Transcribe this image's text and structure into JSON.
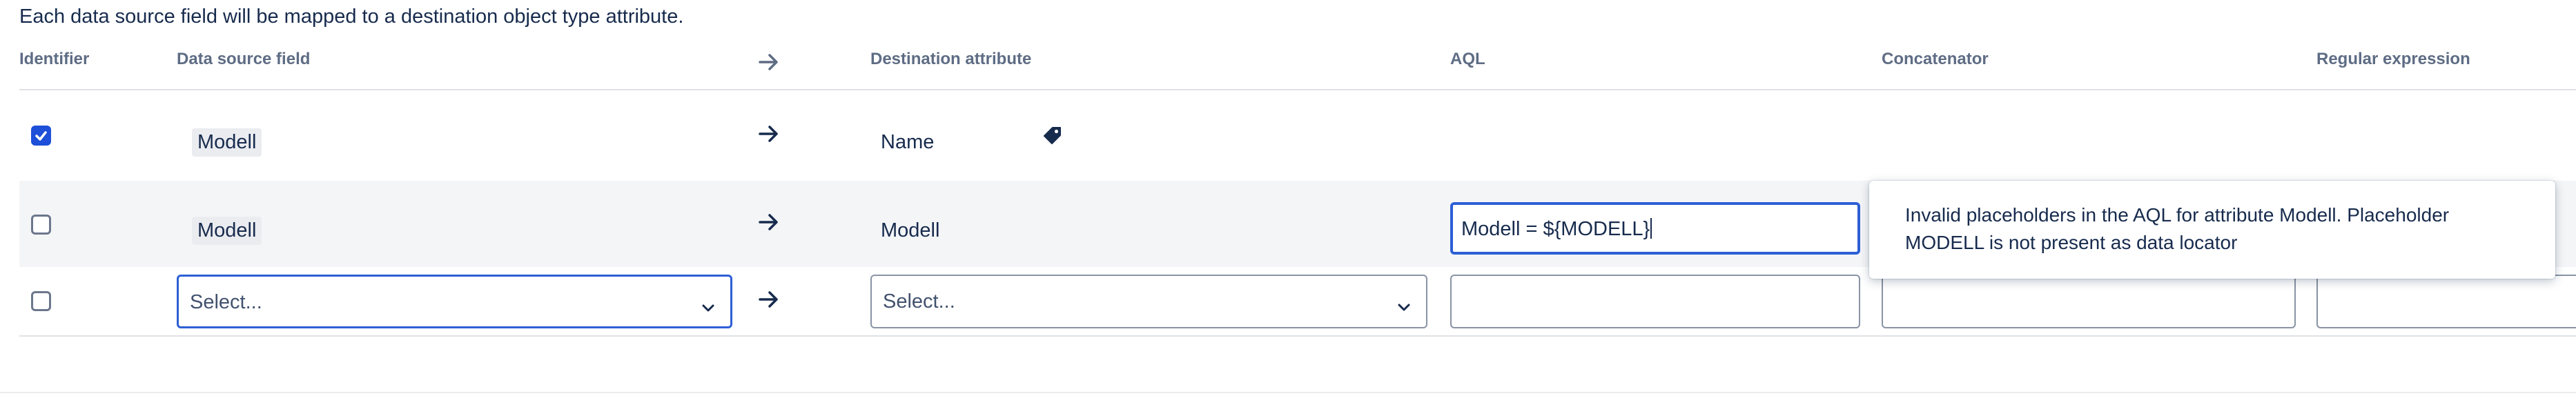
{
  "intro_text": "Each data source field will be mapped to a destination object type attribute.",
  "headers": {
    "identifier": "Identifier",
    "data_source_field": "Data source field",
    "destination_attribute": "Destination attribute",
    "aql": "AQL",
    "concatenator": "Concatenator",
    "regular_expression": "Regular expression"
  },
  "rows": [
    {
      "identifier_checked": true,
      "data_source_field": "Modell",
      "destination_attribute": "Name",
      "destination_icon": "tag-icon"
    },
    {
      "identifier_checked": false,
      "data_source_field": "Modell",
      "destination_attribute": "Modell",
      "aql_value": "Modell = ${MODELL}"
    }
  ],
  "new_row": {
    "identifier_checked": false,
    "data_source_placeholder": "Select...",
    "destination_placeholder": "Select...",
    "aql_value": "",
    "concatenator_value": "",
    "regex_value": ""
  },
  "tooltip": {
    "message": "Invalid placeholders in the AQL for attribute Modell. Placeholder MODELL is not present as data locator"
  },
  "icons": [
    "arrow-right-icon",
    "check-icon",
    "tag-icon",
    "chevron-down-icon"
  ],
  "colors": {
    "accent": "#2c5fd5",
    "checkbox_checked": "#1d4fd8",
    "row_highlight": "#f4f5f7"
  }
}
